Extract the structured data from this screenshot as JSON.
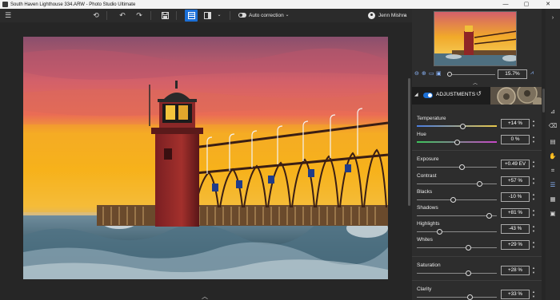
{
  "window": {
    "title": "South Haven Lighthouse 334.ARW - Photo Studio Ultimate",
    "minimize": "—",
    "maximize": "▢",
    "close": "✕"
  },
  "toolbar": {
    "menu_icon": "hamburger-icon",
    "auto_correction_label": "Auto correction",
    "user_name": "Jenn Mishra"
  },
  "navigator": {
    "zoom_value": "15.7%",
    "icons": [
      "zoom-out-icon",
      "zoom-in-icon",
      "fit-icon",
      "actual-size-icon",
      "histogram-icon"
    ]
  },
  "adjustments": {
    "header_label": "ADJUSTMENTS",
    "items": [
      {
        "name": "Temperature",
        "value": "+14 %",
        "pos": 0.57,
        "track": "temp"
      },
      {
        "name": "Hue",
        "value": "0 %",
        "pos": 0.5,
        "track": "hue"
      },
      {
        "name": "Exposure",
        "value": "+0.49 EV",
        "pos": 0.56,
        "track": "plain"
      },
      {
        "name": "Contrast",
        "value": "+57 %",
        "pos": 0.78,
        "track": "plain"
      },
      {
        "name": "Blacks",
        "value": "-10 %",
        "pos": 0.45,
        "track": "plain"
      },
      {
        "name": "Shadows",
        "value": "+81 %",
        "pos": 0.9,
        "track": "plain"
      },
      {
        "name": "Highlights",
        "value": "-43 %",
        "pos": 0.28,
        "track": "plain"
      },
      {
        "name": "Whites",
        "value": "+29 %",
        "pos": 0.64,
        "track": "plain"
      },
      {
        "name": "Saturation",
        "value": "+28 %",
        "pos": 0.64,
        "track": "plain"
      },
      {
        "name": "Clarity",
        "value": "+33 %",
        "pos": 0.66,
        "track": "plain"
      }
    ]
  },
  "rail": {
    "icons": [
      "expand-panel-icon",
      "adjust-icon",
      "eraser-icon",
      "film-icon",
      "hand-icon",
      "crop-icon",
      "sliders-icon",
      "grid-icon",
      "image-icon"
    ]
  },
  "colors": {
    "accent": "#1b6fd6",
    "panel_bg": "#2d2d2d",
    "canvas_bg": "#262626",
    "titlebar_bg": "#f3f3f3"
  }
}
